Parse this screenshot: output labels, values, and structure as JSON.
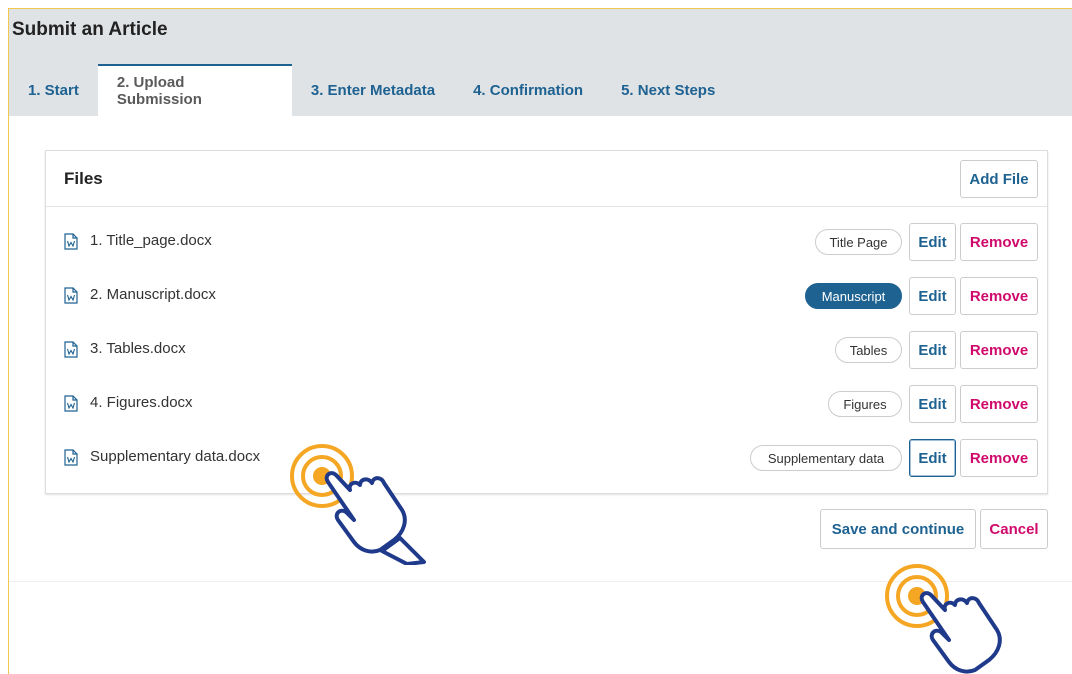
{
  "page": {
    "title": "Submit an Article"
  },
  "tabs": [
    {
      "label": "1. Start",
      "active": false
    },
    {
      "label": "2. Upload Submission",
      "active": true
    },
    {
      "label": "3. Enter Metadata",
      "active": false
    },
    {
      "label": "4. Confirmation",
      "active": false
    },
    {
      "label": "5. Next Steps",
      "active": false
    }
  ],
  "files_panel": {
    "title": "Files",
    "add_file_label": "Add File",
    "edit_label": "Edit",
    "remove_label": "Remove",
    "rows": [
      {
        "name": "1. Title_page.docx",
        "genre": "Title Page",
        "genre_selected": false
      },
      {
        "name": "2. Manuscript.docx",
        "genre": "Manuscript",
        "genre_selected": true
      },
      {
        "name": "3. Tables.docx",
        "genre": "Tables",
        "genre_selected": false
      },
      {
        "name": "4. Figures.docx",
        "genre": "Figures",
        "genre_selected": false
      },
      {
        "name": "Supplementary data.docx",
        "genre": "Supplementary data",
        "genre_selected": false
      }
    ]
  },
  "actions": {
    "save_label": "Save and continue",
    "cancel_label": "Cancel"
  },
  "colors": {
    "link_blue": "#1e6292",
    "remove_pink": "#d00a6c",
    "tap_orange": "#f5a623",
    "hand_navy": "#1f3a8a"
  },
  "icons": {
    "file": "word-document-icon",
    "pointer": "tap-hand-icon"
  }
}
